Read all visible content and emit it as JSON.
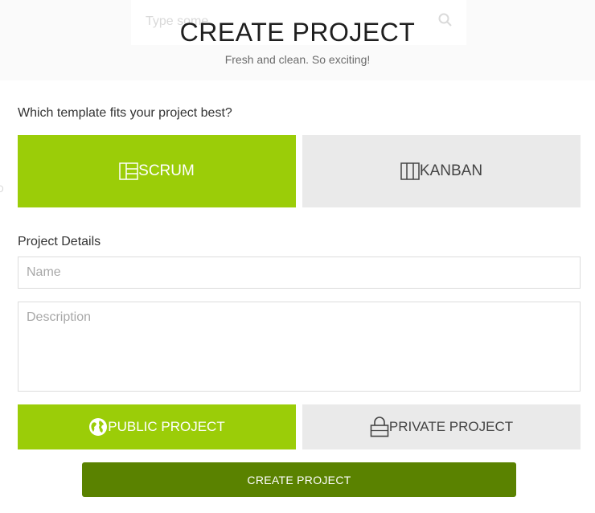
{
  "background": {
    "search_placeholder": "Type some",
    "side_glyph": "D"
  },
  "header": {
    "title": "CREATE PROJECT",
    "subtitle": "Fresh and clean. So exciting!"
  },
  "template_section": {
    "question": "Which template fits your project best?",
    "options": [
      {
        "label": "SCRUM",
        "icon": "scrum-board-icon",
        "selected": true
      },
      {
        "label": "KANBAN",
        "icon": "kanban-board-icon",
        "selected": false
      }
    ]
  },
  "details_section": {
    "label": "Project Details",
    "name_placeholder": "Name",
    "name_value": "",
    "description_placeholder": "Description",
    "description_value": ""
  },
  "visibility": {
    "options": [
      {
        "label": "PUBLIC PROJECT",
        "icon": "globe-icon",
        "selected": true
      },
      {
        "label": "PRIVATE PROJECT",
        "icon": "lock-icon",
        "selected": false
      }
    ]
  },
  "actions": {
    "create_label": "CREATE PROJECT"
  },
  "colors": {
    "accent_green": "#9bcd08",
    "button_dark_green": "#5a8200",
    "inactive_gray": "#eaeaea"
  }
}
